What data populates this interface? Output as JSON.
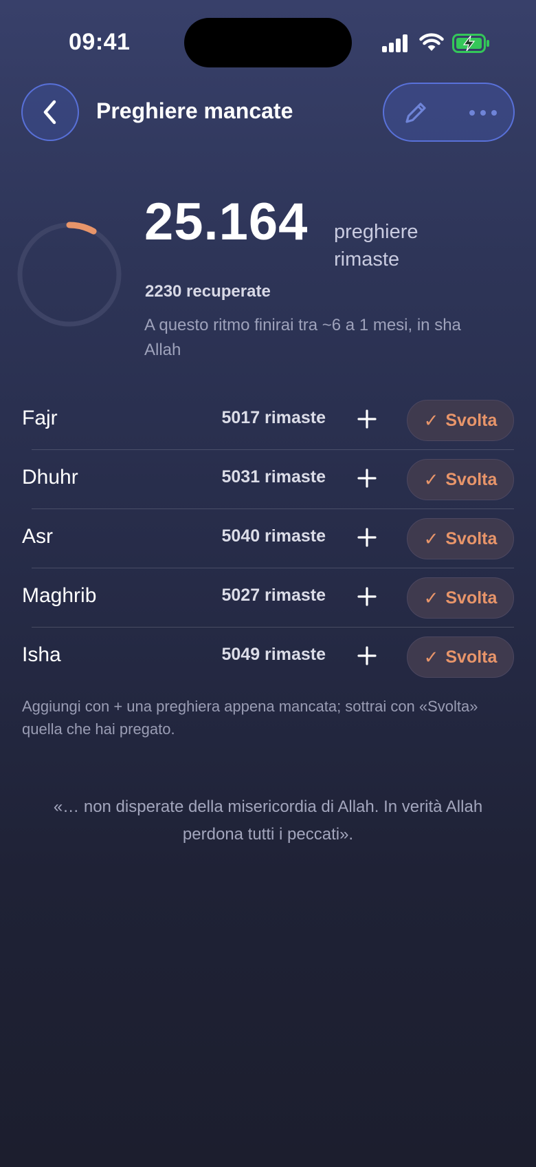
{
  "status_bar": {
    "time": "09:41"
  },
  "header": {
    "title": "Preghiere mancate",
    "back_icon": "chevron-left-icon",
    "edit_icon": "pencil-icon",
    "more_icon": "ellipsis-icon"
  },
  "summary": {
    "total": "25.164",
    "unit": "preghiere rimaste",
    "recovered": "2230 recuperate",
    "estimate": "A questo ritmo finirai tra ~6 a 1 mesi, in sha Allah",
    "progress_fraction": 0.081
  },
  "prayers": [
    {
      "name": "Fajr",
      "remaining": "5017 rimaste",
      "add_label": "+",
      "done_label": "Svolta"
    },
    {
      "name": "Dhuhr",
      "remaining": "5031 rimaste",
      "add_label": "+",
      "done_label": "Svolta"
    },
    {
      "name": "Asr",
      "remaining": "5040 rimaste",
      "add_label": "+",
      "done_label": "Svolta"
    },
    {
      "name": "Maghrib",
      "remaining": "5027 rimaste",
      "add_label": "+",
      "done_label": "Svolta"
    },
    {
      "name": "Isha",
      "remaining": "5049 rimaste",
      "add_label": "+",
      "done_label": "Svolta"
    }
  ],
  "done_check": "✓",
  "hint": "Aggiungi con + una preghiera appena mancata; sottrai con «Svolta» quella che hai pregato.",
  "quote": "«… non disperate della misericordia di Allah. In verità Allah perdona tutti i peccati».",
  "colors": {
    "accent": "#e8956a",
    "outline": "#627cf0",
    "battery": "#34c759"
  }
}
